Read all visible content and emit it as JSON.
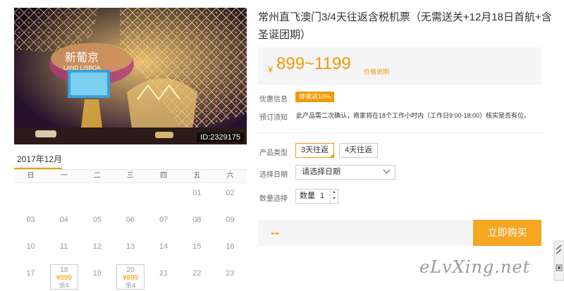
{
  "hero": {
    "id_label": "ID:2329175",
    "sign_text": "新葡京",
    "sign_sub": "LAND LISBOA"
  },
  "calendar": {
    "month": "2017年12月",
    "weekdays": [
      "日",
      "一",
      "二",
      "三",
      "四",
      "五",
      "六"
    ],
    "rows": [
      [
        {
          "d": ""
        },
        {
          "d": ""
        },
        {
          "d": ""
        },
        {
          "d": ""
        },
        {
          "d": ""
        },
        {
          "d": "01"
        },
        {
          "d": "02"
        }
      ],
      [
        {
          "d": "03"
        },
        {
          "d": "04"
        },
        {
          "d": "05"
        },
        {
          "d": "06"
        },
        {
          "d": "07"
        },
        {
          "d": "08"
        },
        {
          "d": "09"
        }
      ],
      [
        {
          "d": "10"
        },
        {
          "d": "11"
        },
        {
          "d": "12"
        },
        {
          "d": "13"
        },
        {
          "d": "14"
        },
        {
          "d": "15"
        },
        {
          "d": "16"
        }
      ],
      [
        {
          "d": "17"
        },
        {
          "d": "18",
          "price": "¥899",
          "stock": "余4"
        },
        {
          "d": "19"
        },
        {
          "d": "20",
          "price": "¥899",
          "stock": "余4"
        },
        {
          "d": "21"
        },
        {
          "d": "22"
        },
        {
          "d": "23"
        }
      ]
    ]
  },
  "product": {
    "title": "常州直飞澳门3/4天往返含税机票（无需送关+12月18日首航+含圣诞团期）",
    "price_symbol": "¥",
    "price_range": "899~1199",
    "price_note": "价格说明",
    "promo_label": "优惠信息",
    "promo_badge": "蜂蜜返10%",
    "notice_label": "预订须知",
    "notice_text": "此产品需二次确认，商家将在18个工作小时内（工作日9:00-18:00）核实是否有位。",
    "type_label": "产品类型",
    "type_options": [
      "3天往返",
      "4天往返"
    ],
    "date_label": "选择日期",
    "date_placeholder": "请选择日期",
    "qty_label": "数量选择",
    "qty_prefix": "数量",
    "qty_value": "1",
    "total": "--",
    "buy_label": "立即购买"
  },
  "watermark": "eLvXing.net",
  "colors": {
    "accent": "#f39800",
    "buy": "#f5a623"
  }
}
